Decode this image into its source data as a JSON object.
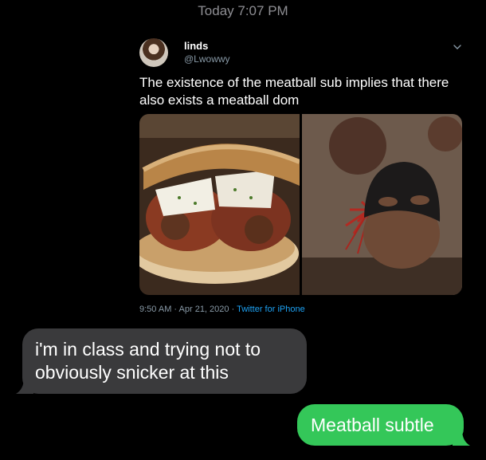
{
  "thread": {
    "timestamp": "Today 7:07 PM"
  },
  "tweet": {
    "author_name": "linds",
    "author_handle": "@Lwowwy",
    "text": "The existence of the meatball sub implies that there also exists a meatball dom",
    "posted_at": "9:50 AM · Apr 21, 2020 ·",
    "source": "Twitter for iPhone",
    "images": [
      "meatball-sub-sandwich-image",
      "masked-meatball-with-whip-image"
    ],
    "menu_icon": "chevron-down-icon"
  },
  "messages": [
    {
      "direction": "incoming",
      "text": "i'm in class and trying not to obviously snicker at this",
      "color": "#3a3a3c"
    },
    {
      "direction": "outgoing",
      "text": "Meatball subtle",
      "color": "#34c759"
    }
  ],
  "colors": {
    "background": "#000000",
    "timestamp": "#8e8e93",
    "handle": "#8899a6",
    "link": "#1da1f2"
  }
}
